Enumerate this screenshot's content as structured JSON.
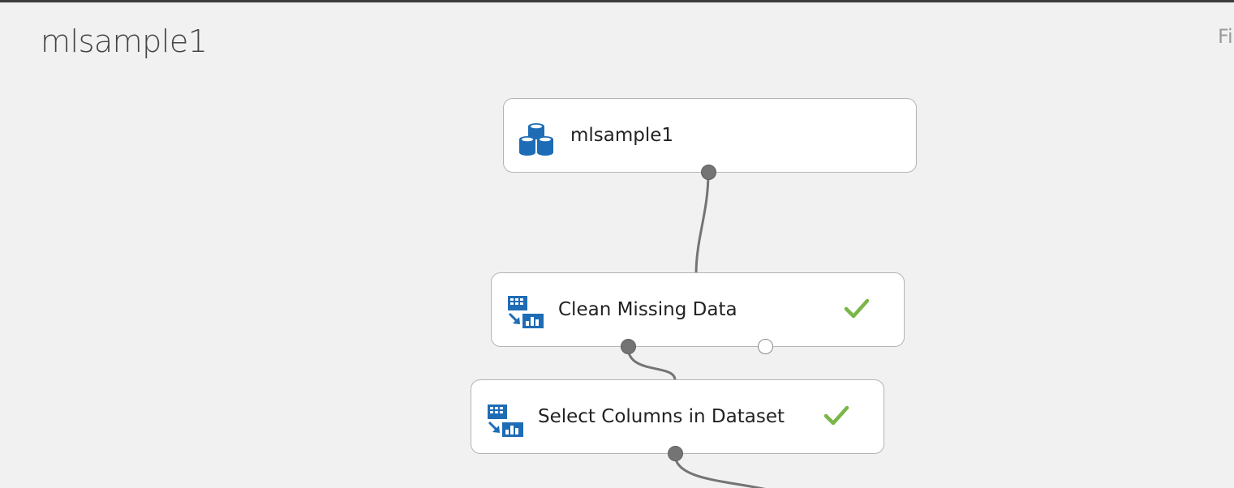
{
  "experiment": {
    "title": "mlsample1",
    "right_truncated_text": "Fi"
  },
  "modules": [
    {
      "label": "mlsample1",
      "icon": "dataset-icon",
      "status": "none"
    },
    {
      "label": "Clean Missing Data",
      "icon": "data-transform-icon",
      "status": "completed"
    },
    {
      "label": "Select Columns in Dataset",
      "icon": "data-transform-icon",
      "status": "completed"
    }
  ],
  "colors": {
    "icon_blue": "#1e6cb5",
    "check_green": "#7ab648",
    "wire_gray": "#747474"
  }
}
